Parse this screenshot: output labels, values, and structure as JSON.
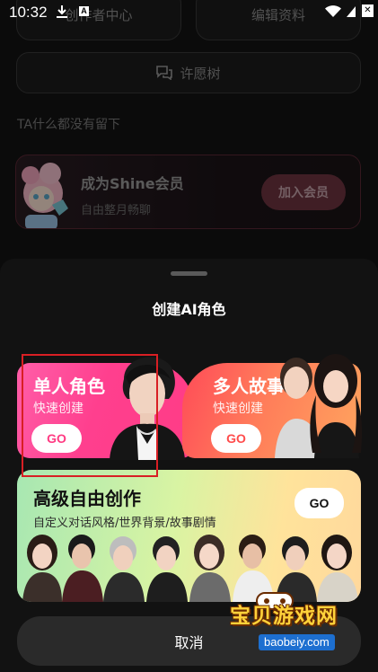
{
  "status_bar": {
    "time": "10:32",
    "a_badge": "A"
  },
  "profile": {
    "creator_center": "创作者中心",
    "edit_profile": "编辑资料",
    "wish_tree": "许愿树",
    "no_message": "TA什么都没有留下",
    "member": {
      "title": "成为Shine会员",
      "subtitle": "自由整月畅聊",
      "join": "加入会员"
    }
  },
  "sheet": {
    "title": "创建AI角色",
    "single": {
      "title": "单人角色",
      "subtitle": "快速创建",
      "go": "GO"
    },
    "multi": {
      "title": "多人故事",
      "subtitle": "快速创建",
      "go": "GO"
    },
    "advanced": {
      "title": "高级自由创作",
      "subtitle": "自定义对话风格/世界背景/故事剧情",
      "go": "GO"
    },
    "cancel": "取消"
  },
  "watermark": {
    "brand": "宝贝游戏网",
    "url": "baobeiy.com"
  },
  "colors": {
    "single_card": "#ff3f8e",
    "multi_card": "#ff7d5a",
    "highlight": "#d81f24"
  }
}
